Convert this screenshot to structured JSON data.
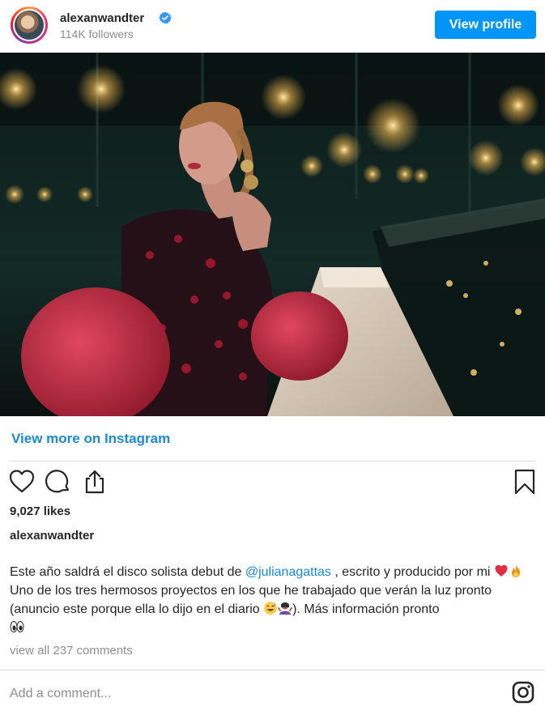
{
  "header": {
    "username": "alexanwandter",
    "followers": "114K followers",
    "view_profile_label": "View profile"
  },
  "post": {
    "image_alt": "Woman in red polka-dot dress seated at a lit counter in a dim bar"
  },
  "links": {
    "view_more": "View more on Instagram"
  },
  "actions": {
    "icons": [
      "heart-icon",
      "comment-icon",
      "share-icon",
      "bookmark-icon"
    ]
  },
  "likes": "9,027 likes",
  "caption": {
    "username": "alexanwandter",
    "text_1": "Este año saldrá el disco solista debut de ",
    "mention": "@julianagattas",
    "text_2": " , escrito y producido por mi ",
    "text_3": " Uno de los tres hermosos proyectos en los que he trabajado que verán la luz pronto (anuncio este porque ella lo dijo en el diario ",
    "text_4": "). Más información pronto"
  },
  "comments": {
    "view_all": "view all 237 comments",
    "placeholder": "Add a comment..."
  },
  "colors": {
    "accent": "#0095f6",
    "link": "#1a8ad4",
    "muted": "#8e8e8e"
  }
}
